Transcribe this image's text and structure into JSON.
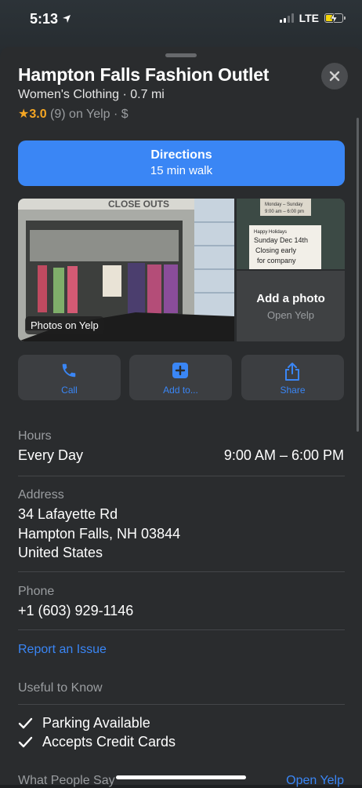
{
  "status_bar": {
    "time": "5:13",
    "network": "LTE"
  },
  "place": {
    "name": "Hampton Falls Fashion Outlet",
    "subtitle": "Women's Clothing · 0.7 mi",
    "rating_score": "3.0",
    "rating_rest": "(9) on Yelp · $"
  },
  "directions": {
    "label": "Directions",
    "detail": "15 min walk"
  },
  "photos": {
    "badge": "Photos on Yelp",
    "storefront_sign": "CLOSE OUTS",
    "sign_lines": [
      "Monday – Sunday",
      "9:00 am – 6:00 pm",
      "Happy Holidays",
      "Sunday Dec 14th",
      "Closing early",
      "for company"
    ],
    "add_title": "Add a photo",
    "add_sub": "Open Yelp"
  },
  "actions": [
    {
      "label": "Call",
      "icon": "phone-icon"
    },
    {
      "label": "Add to...",
      "icon": "plus-square-icon"
    },
    {
      "label": "Share",
      "icon": "share-icon"
    }
  ],
  "hours": {
    "label": "Hours",
    "days": "Every Day",
    "time": "9:00 AM – 6:00 PM"
  },
  "address": {
    "label": "Address",
    "line1": "34 Lafayette Rd",
    "line2": "Hampton Falls, NH  03844",
    "line3": "United States"
  },
  "phone": {
    "label": "Phone",
    "number": "+1 (603) 929-1146"
  },
  "report_issue": "Report an Issue",
  "useful": {
    "label": "Useful to Know",
    "items": [
      "Parking Available",
      "Accepts Credit Cards"
    ]
  },
  "reviews": {
    "label": "What People Say",
    "link": "Open Yelp"
  },
  "colors": {
    "accent": "#3a86f5",
    "star": "#f5a623",
    "sheet": "#2a2c2e"
  }
}
